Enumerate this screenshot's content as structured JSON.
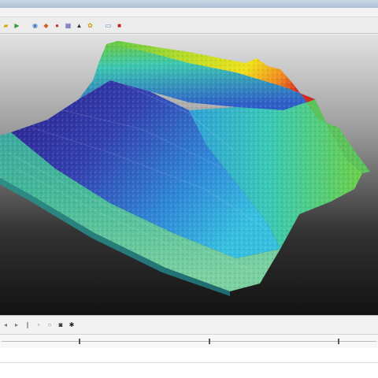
{
  "window": {
    "title_bar_color": "#b8c8dc"
  },
  "menu": {
    "items": [
      {
        "label": ""
      },
      {
        "label": ""
      },
      {
        "label": ""
      },
      {
        "label": ""
      },
      {
        "label": ""
      }
    ]
  },
  "toolbar": {
    "buttons": [
      {
        "icon": "open-icon",
        "color": "#d8a400"
      },
      {
        "icon": "play-icon",
        "color": "#3a9a3a"
      },
      {
        "icon": "zoom-icon",
        "color": "#3a78c8"
      },
      {
        "icon": "layers-icon",
        "color": "#d06020"
      },
      {
        "icon": "color-wheel-icon",
        "color": "#c03030"
      },
      {
        "icon": "grid-icon",
        "color": "#5a5ab0"
      },
      {
        "icon": "camera-icon",
        "color": "#333333"
      },
      {
        "icon": "palette-icon",
        "color": "#d09a00"
      },
      {
        "icon": "monitor-icon",
        "color": "#3a78c8"
      },
      {
        "icon": "record-icon",
        "color": "#c02020"
      }
    ]
  },
  "viewport": {
    "background_top": "#e2e2e2",
    "background_bottom": "#121212",
    "colormap": [
      "#2b1a88",
      "#2f6fd0",
      "#35b8e0",
      "#3cd0a8",
      "#88d040",
      "#e8e020",
      "#f08020",
      "#d02020"
    ]
  },
  "bottom_toolbar": {
    "buttons": [
      {
        "icon": "step-back-icon"
      },
      {
        "icon": "play-icon"
      },
      {
        "icon": "pause-icon"
      },
      {
        "icon": "stop-icon"
      },
      {
        "icon": "record-icon"
      },
      {
        "icon": "camera-icon"
      },
      {
        "icon": "settings-icon"
      }
    ]
  },
  "timeline": {
    "markers": [
      0.21,
      0.555,
      0.895
    ]
  }
}
